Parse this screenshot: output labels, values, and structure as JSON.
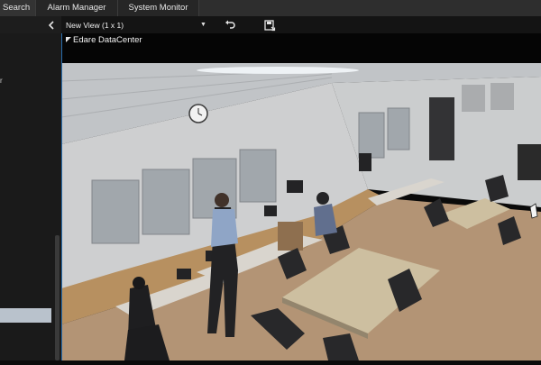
{
  "tabs": [
    {
      "label": "Search"
    },
    {
      "label": "Alarm Manager"
    },
    {
      "label": "System Monitor"
    }
  ],
  "viewbar": {
    "view_name": "New View (1 x 1)"
  },
  "camera": {
    "name": "Edare DataCenter"
  },
  "icons": {
    "collapse": "chevron-left-icon",
    "dropdown": "caret-down-icon",
    "restore": "undo-arrow-icon",
    "save": "save-view-icon",
    "camera": "camera-triangle-icon"
  },
  "colors": {
    "tile_accent": "#2a6dab",
    "selected_item": "#b9c2cc"
  }
}
